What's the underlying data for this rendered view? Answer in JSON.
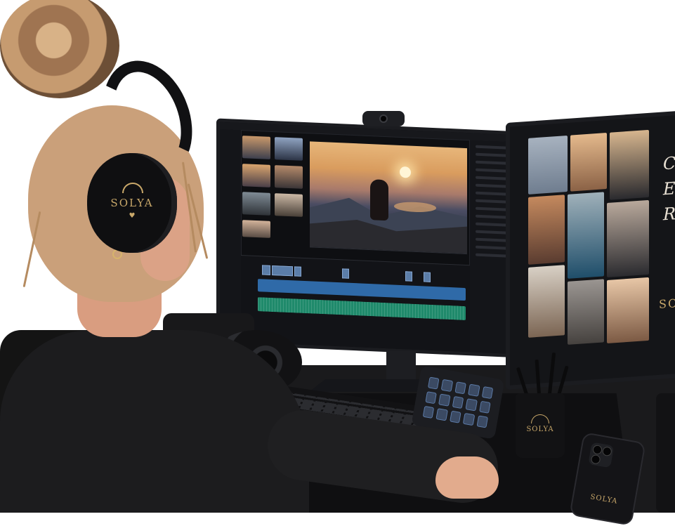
{
  "brand": {
    "headphone_logo": "SOLYA",
    "headphone_heart": "♥",
    "cup_logo": "SOLYA",
    "phone_logo": "SOLYA",
    "screen_logo": "SO"
  },
  "screen_side_text": [
    "C",
    "E",
    "R"
  ],
  "colors": {
    "brand_gold": "#c9a86a",
    "timeline_clip": "#5b7da8",
    "timeline_blue": "#2f6aa8",
    "timeline_audio": "#1f8a6b"
  },
  "icons": [
    "camera-icon",
    "sun-icon",
    "heart-icon"
  ]
}
